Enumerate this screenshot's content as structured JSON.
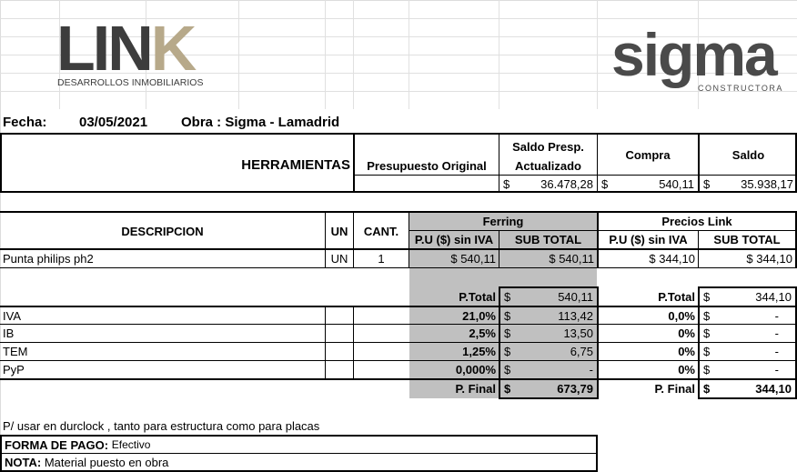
{
  "link_logo": {
    "word": "LIN",
    "k": "K",
    "subtitle": "DESARROLLOS INMOBILIARIOS"
  },
  "sigma_logo": {
    "word": "sigma",
    "subtitle": "CONSTRUCTORA"
  },
  "header": {
    "fecha_label": "Fecha:",
    "fecha_value": "03/05/2021",
    "obra": "Obra : Sigma - Lamadrid"
  },
  "summary": {
    "herramientas": "HERRAMIENTAS",
    "presupuesto_original": "Presupuesto Original",
    "saldo_presp_1": "Saldo Presp.",
    "saldo_presp_2": "Actualizado",
    "compra": "Compra",
    "saldo": "Saldo",
    "currency": "$",
    "saldo_presp_value": "36.478,28",
    "compra_value": "540,11",
    "saldo_value": "35.938,17"
  },
  "table": {
    "descripcion": "DESCRIPCION",
    "un": "UN",
    "cant": "CANT.",
    "ferring": "Ferring",
    "precios_link": "Precios Link",
    "pu_sin_iva": "P.U ($) sin IVA",
    "sub_total": "SUB TOTAL",
    "item": {
      "desc": "Punta philips ph2",
      "un": "UN",
      "cant": "1",
      "f_pu": "$ 540,11",
      "f_sub": "$ 540,11",
      "l_pu": "$ 344,10",
      "l_sub": "$ 344,10"
    }
  },
  "totals": {
    "ptotal_label": "P.Total",
    "currency": "$",
    "f_ptotal": "540,11",
    "l_ptotal": "344,10",
    "rows": [
      {
        "label": "IVA",
        "f_pct": "21,0%",
        "f_val": "113,42",
        "l_pct": "0,0%",
        "l_val": "-"
      },
      {
        "label": "IB",
        "f_pct": "2,5%",
        "f_val": "13,50",
        "l_pct": "0%",
        "l_val": "-"
      },
      {
        "label": "TEM",
        "f_pct": "1,25%",
        "f_val": "6,75",
        "l_pct": "0%",
        "l_val": "-"
      },
      {
        "label": "PyP",
        "f_pct": "0,000%",
        "f_val": "-",
        "l_pct": "0%",
        "l_val": "-"
      }
    ],
    "pfinal_label": "P. Final",
    "f_pfinal": "673,79",
    "l_pfinal": "344,10"
  },
  "notes": {
    "note1": "P/ usar en durclock , tanto para estructura como para placas",
    "forma_label": "FORMA DE PAGO:",
    "forma_value": "Efectivo",
    "nota_label": "NOTA:",
    "nota_value": "Material puesto en obra"
  },
  "colors": {
    "link_dark": "#3d3d3d",
    "link_gold": "#b7a98a",
    "sigma": "#4a4a4a",
    "gray_fill": "#c0c0c0"
  }
}
